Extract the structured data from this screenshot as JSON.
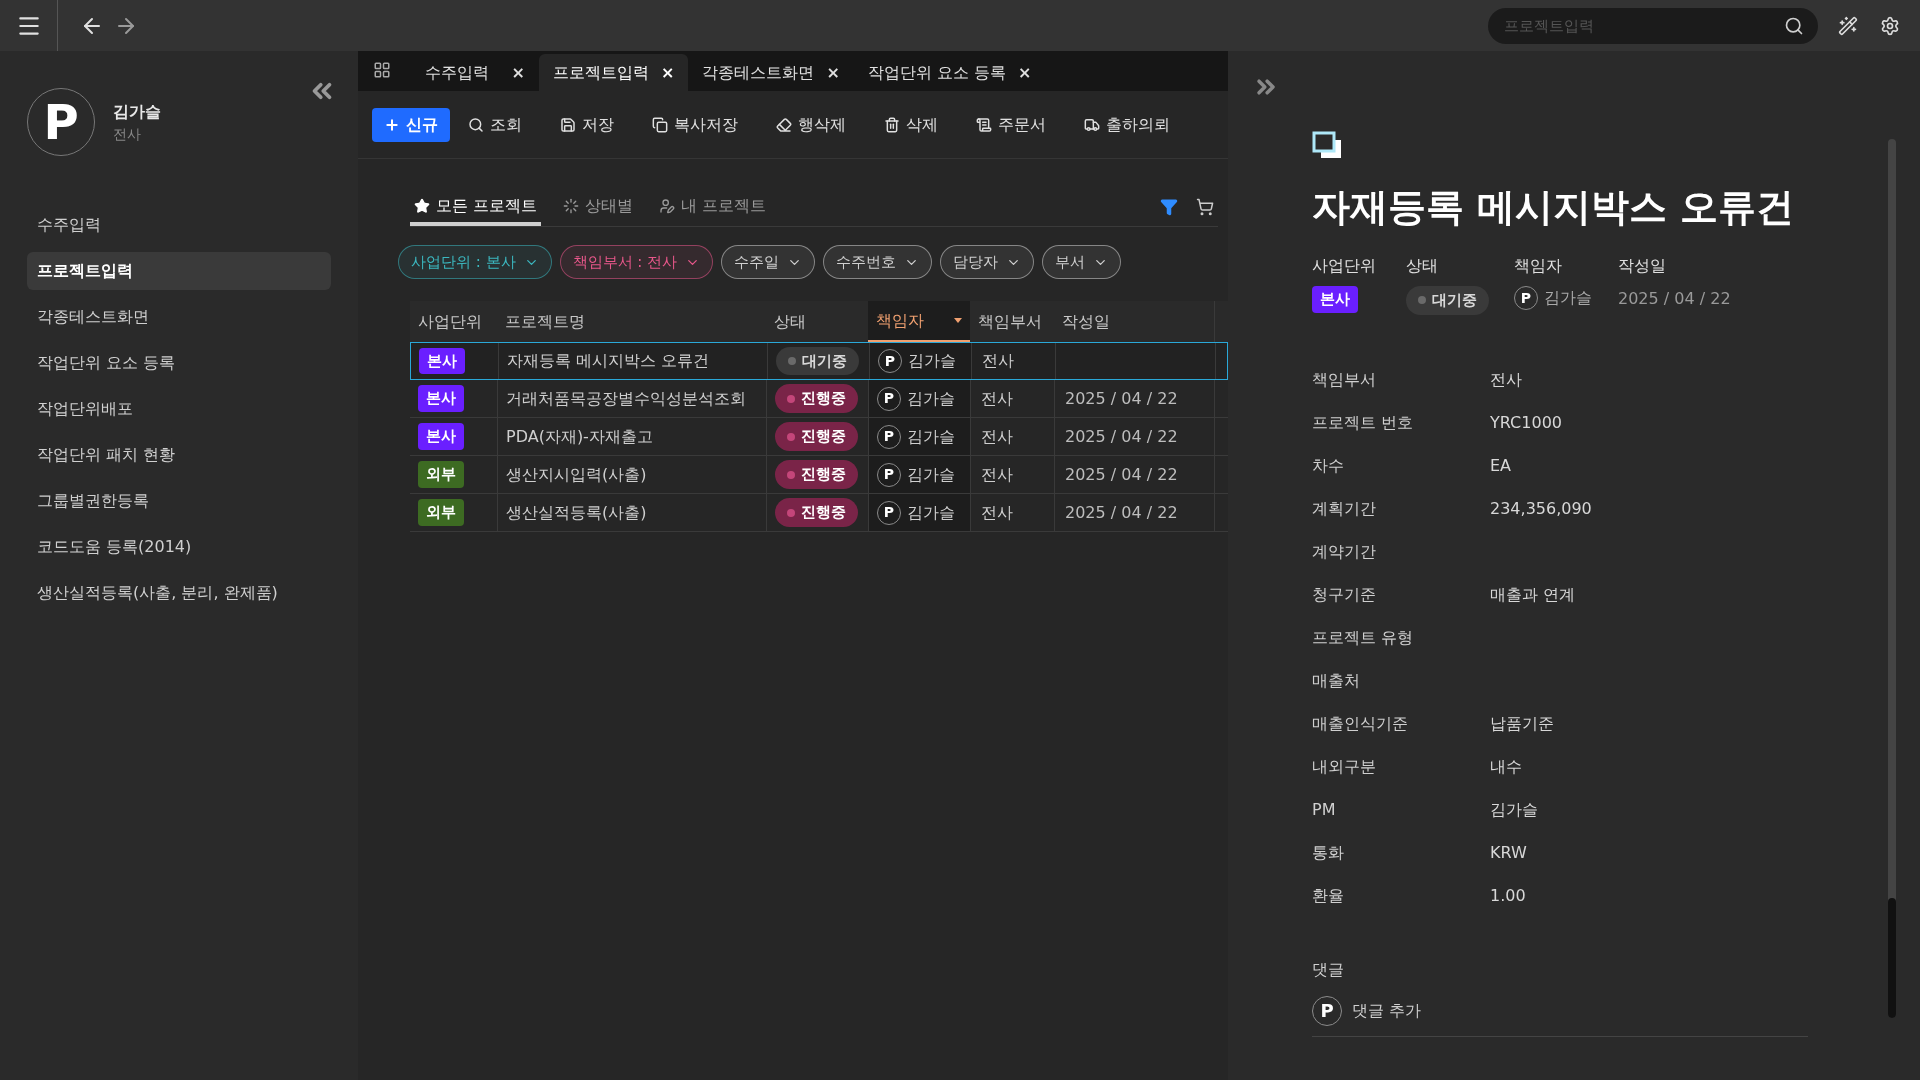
{
  "topbar": {
    "search": {
      "placeholder": "프로젝트입력"
    }
  },
  "user": {
    "avatar": "P",
    "name": "김가슬",
    "dept": "전사"
  },
  "sidebar": {
    "items": [
      {
        "label": "수주입력",
        "selected": false
      },
      {
        "label": "프로젝트입력",
        "selected": true
      },
      {
        "label": "각종테스트화면",
        "selected": false
      },
      {
        "label": "작업단위 요소 등록",
        "selected": false
      },
      {
        "label": "작업단위배포",
        "selected": false
      },
      {
        "label": "작업단위 패치 현황",
        "selected": false
      },
      {
        "label": "그룹별권한등록",
        "selected": false
      },
      {
        "label": "코드도움 등록(2014)",
        "selected": false
      },
      {
        "label": "생산실적등록(사출, 분리, 완제품)",
        "selected": false
      }
    ]
  },
  "tabs": [
    {
      "label": "수주입력",
      "selected": false,
      "close": "×"
    },
    {
      "label": "프로젝트입력",
      "selected": true,
      "close": "×"
    },
    {
      "label": "각종테스트화면",
      "selected": false,
      "close": "×"
    },
    {
      "label": "작업단위 요소 등록",
      "selected": false,
      "close": "×"
    }
  ],
  "toolbar": [
    {
      "label": "신규",
      "kind": "primary"
    },
    {
      "label": "조회",
      "kind": "plain"
    },
    {
      "label": "저장",
      "kind": "plain"
    },
    {
      "label": "복사저장",
      "kind": "plain"
    },
    {
      "label": "행삭제",
      "kind": "plain"
    },
    {
      "label": "삭제",
      "kind": "plain"
    },
    {
      "label": "주문서",
      "kind": "plain"
    },
    {
      "label": "출하의뢰",
      "kind": "plain"
    }
  ],
  "view_tabs": [
    {
      "label": "모든 프로젝트",
      "selected": true
    },
    {
      "label": "상태별",
      "selected": false
    },
    {
      "label": "내 프로젝트",
      "selected": false
    }
  ],
  "filters": [
    {
      "label": "사업단위 : 본사",
      "color": "#3bb8c0"
    },
    {
      "label": "책임부서 : 전사",
      "color": "#e8578a"
    },
    {
      "label": "수주일",
      "color": "#d0d0d0"
    },
    {
      "label": "수주번호",
      "color": "#d0d0d0"
    },
    {
      "label": "담당자",
      "color": "#d0d0d0"
    },
    {
      "label": "부서",
      "color": "#d0d0d0"
    }
  ],
  "table": {
    "columns": [
      {
        "label": "사업단위",
        "sorted": false
      },
      {
        "label": "프로젝트명",
        "sorted": false
      },
      {
        "label": "상태",
        "sorted": false
      },
      {
        "label": "책임자",
        "sorted": true
      },
      {
        "label": "책임부서",
        "sorted": false
      },
      {
        "label": "작성일",
        "sorted": false
      }
    ],
    "rows": [
      {
        "selected": true,
        "unit": {
          "label": "본사",
          "color": "#6a1fff"
        },
        "name": "자재등록 메시지박스 오류건",
        "status": {
          "label": "대기중",
          "kind": "waiting"
        },
        "owner": {
          "avatar": "P",
          "name": "김가슬"
        },
        "dept": "전사"
      },
      {
        "selected": false,
        "unit": {
          "label": "본사",
          "color": "#6a1fff"
        },
        "name": "거래처품목공장별수익성분석조회",
        "status": {
          "label": "진행중",
          "kind": "progress"
        },
        "owner": {
          "avatar": "P",
          "name": "김가슬"
        },
        "dept": "전사",
        "date": "2025 / 04 / 22"
      },
      {
        "selected": false,
        "unit": {
          "label": "본사",
          "color": "#6a1fff"
        },
        "name": "PDA(자재)-자재출고",
        "status": {
          "label": "진행중",
          "kind": "progress"
        },
        "owner": {
          "avatar": "P",
          "name": "김가슬"
        },
        "dept": "전사",
        "date": "2025 / 04 / 22"
      },
      {
        "selected": false,
        "unit": {
          "label": "외부",
          "color": "#3d6b22"
        },
        "name": "생산지시입력(사출)",
        "status": {
          "label": "진행중",
          "kind": "progress"
        },
        "owner": {
          "avatar": "P",
          "name": "김가슬"
        },
        "dept": "전사",
        "date": "2025 / 04 / 22"
      },
      {
        "selected": false,
        "unit": {
          "label": "외부",
          "color": "#3d6b22"
        },
        "name": "생산실적등록(사출)",
        "status": {
          "label": "진행중",
          "kind": "progress"
        },
        "owner": {
          "avatar": "P",
          "name": "김가슬"
        },
        "dept": "전사",
        "date": "2025 / 04 / 22"
      }
    ]
  },
  "detail": {
    "title": "자재등록 메시지박스 오류건",
    "meta": {
      "unit_label": "사업단위",
      "unit": {
        "label": "본사",
        "color": "#6a1fff"
      },
      "status_label": "상태",
      "status": {
        "label": "대기중",
        "kind": "waiting"
      },
      "owner_label": "책임자",
      "owner": {
        "avatar": "P",
        "name": "김가슬"
      },
      "date_label": "작성일",
      "date": "2025 / 04 / 22"
    },
    "fields": [
      {
        "label": "책임부서",
        "value": "전사"
      },
      {
        "label": "프로젝트 번호",
        "value": "YRC1000"
      },
      {
        "label": "차수",
        "value": "EA"
      },
      {
        "label": "계획기간",
        "value": "234,356,090"
      },
      {
        "label": "계약기간"
      },
      {
        "label": "청구기준",
        "value": "매출과 연계"
      },
      {
        "label": "프로젝트 유형"
      },
      {
        "label": "매출처"
      },
      {
        "label": "매출인식기준",
        "value": "납품기준"
      },
      {
        "label": "내외구분",
        "value": "내수"
      },
      {
        "label": "PM",
        "value": "김가슬"
      },
      {
        "label": "통화",
        "value": "KRW"
      },
      {
        "label": "환율",
        "value": "1.00"
      }
    ],
    "comments": {
      "label": "댓글",
      "avatar": "P",
      "placeholder": "댓글 추가"
    }
  }
}
